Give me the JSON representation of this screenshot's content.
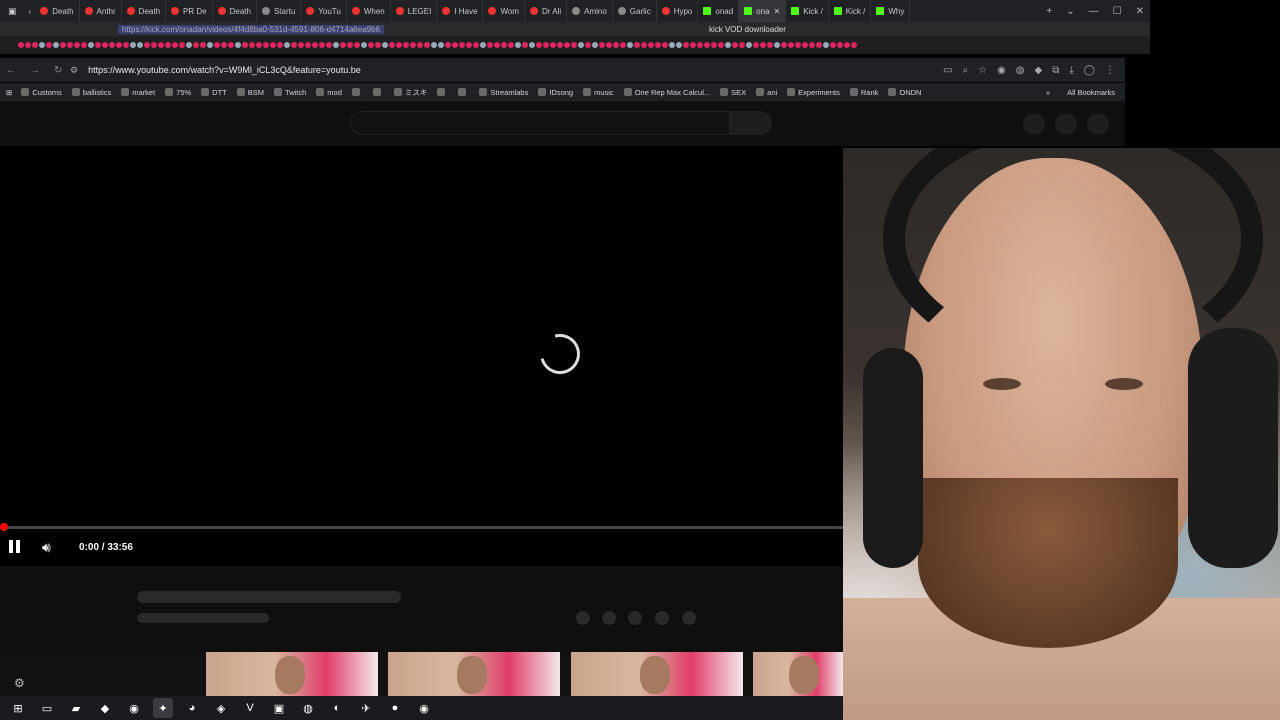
{
  "browser_tabs": [
    {
      "label": "Death",
      "fav": "red"
    },
    {
      "label": "Anthr",
      "fav": "red"
    },
    {
      "label": "Death",
      "fav": "red"
    },
    {
      "label": "PR De",
      "fav": "red"
    },
    {
      "label": "Death",
      "fav": "red"
    },
    {
      "label": "Startu",
      "fav": "grey"
    },
    {
      "label": "YouTu",
      "fav": "red"
    },
    {
      "label": "When",
      "fav": "red"
    },
    {
      "label": "LEGEI",
      "fav": "red"
    },
    {
      "label": "I Have",
      "fav": "red"
    },
    {
      "label": "Wom",
      "fav": "red"
    },
    {
      "label": "Dr Ali",
      "fav": "red"
    },
    {
      "label": "Amino",
      "fav": "grey"
    },
    {
      "label": "Garlic",
      "fav": "grey"
    },
    {
      "label": "Hypo",
      "fav": "red"
    },
    {
      "label": "onad",
      "fav": "green"
    },
    {
      "label": "ona",
      "fav": "green",
      "active": true
    },
    {
      "label": "Kick /",
      "fav": "green"
    },
    {
      "label": "Kick /",
      "fav": "green"
    },
    {
      "label": "Why",
      "fav": "green"
    }
  ],
  "outer_bar": {
    "url": "https://kick.com/onadan/videos/4f4d8ba0-531d-4591-806-d4714a6ea9b6",
    "search_text": "kick VOD downloader"
  },
  "address_bar": {
    "url": "https://www.youtube.com/watch?v=W9Ml_iCL3cQ&feature=youtu.be"
  },
  "bookmarks": [
    "Customs",
    "ballistics",
    "market",
    "75%",
    "DTT",
    "BSM",
    "Twitch",
    "mod",
    "",
    "",
    "ミスキ",
    "",
    "",
    "Streamlabs",
    "IDsong",
    "music",
    "One Rep Max Calcul...",
    "SEX",
    "ani",
    "Experiments",
    "Rank",
    "ONDN"
  ],
  "all_bookmarks_label": "All Bookmarks",
  "player": {
    "current_time": "0:00",
    "duration": "33:56",
    "time_display": "0:00 / 33:56",
    "progress": 0.0,
    "state": "loading"
  },
  "icons": {
    "pause": "pause-icon",
    "volume": "volume-icon",
    "gear": "gear-icon",
    "spinner": "loading-spinner-icon"
  },
  "colors": {
    "progress_red": "#ff0000",
    "kick_green": "#53fc18"
  },
  "taskbar_apps": [
    {
      "name": "start",
      "glyph": "⊞"
    },
    {
      "name": "file-manager",
      "glyph": "▭"
    },
    {
      "name": "folder",
      "glyph": "▰"
    },
    {
      "name": "app-unknown",
      "glyph": "◆"
    },
    {
      "name": "chrome",
      "glyph": "◉"
    },
    {
      "name": "app-active",
      "glyph": "✦",
      "active": true
    },
    {
      "name": "discord",
      "glyph": "◕"
    },
    {
      "name": "steam",
      "glyph": "◈"
    },
    {
      "name": "vortex",
      "glyph": "V"
    },
    {
      "name": "app-blue",
      "glyph": "▣"
    },
    {
      "name": "app-circle",
      "glyph": "◍"
    },
    {
      "name": "app-pink",
      "glyph": "◐"
    },
    {
      "name": "app-wing",
      "glyph": "✈"
    },
    {
      "name": "app-orange",
      "glyph": "●"
    },
    {
      "name": "app-red",
      "glyph": "◉"
    }
  ]
}
